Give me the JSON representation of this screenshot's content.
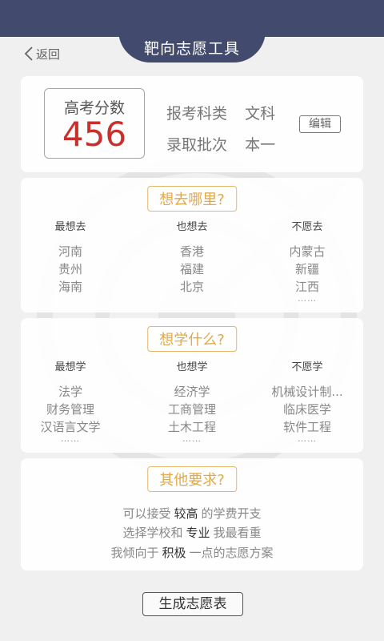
{
  "header": {
    "title": "靶向志愿工具",
    "back_label": "返回"
  },
  "score": {
    "label": "高考分数",
    "value": "456",
    "subject_label": "报考科类",
    "subject_value": "文科",
    "batch_label": "录取批次",
    "batch_value": "本一",
    "edit_label": "编辑"
  },
  "where": {
    "title": "想去哪里?",
    "columns": [
      {
        "heading": "最想去",
        "items": [
          "河南",
          "贵州",
          "海南"
        ],
        "more": ""
      },
      {
        "heading": "也想去",
        "items": [
          "香港",
          "福建",
          "北京"
        ],
        "more": ""
      },
      {
        "heading": "不愿去",
        "items": [
          "内蒙古",
          "新疆",
          "江西"
        ],
        "more": "……"
      }
    ]
  },
  "study": {
    "title": "想学什么?",
    "columns": [
      {
        "heading": "最想学",
        "items": [
          "法学",
          "财务管理",
          "汉语言文学"
        ],
        "more": "……"
      },
      {
        "heading": "也想学",
        "items": [
          "经济学",
          "工商管理",
          "土木工程"
        ],
        "more": "……"
      },
      {
        "heading": "不愿学",
        "items": [
          "机械设计制...",
          "临床医学",
          "软件工程"
        ],
        "more": "……"
      }
    ]
  },
  "other": {
    "title": "其他要求?",
    "lines": [
      {
        "pre": "可以接受",
        "highlight": "较高",
        "post": "的学费开支"
      },
      {
        "pre": "选择学校和",
        "highlight": "专业",
        "post": "我最看重"
      },
      {
        "pre": "我倾向于",
        "highlight": "积极",
        "post": "一点的志愿方案"
      }
    ]
  },
  "generate_label": "生成志愿表",
  "colors": {
    "header_bg": "#424a6e",
    "score_red": "#c9302c",
    "pill_gold": "#e0a94a"
  }
}
